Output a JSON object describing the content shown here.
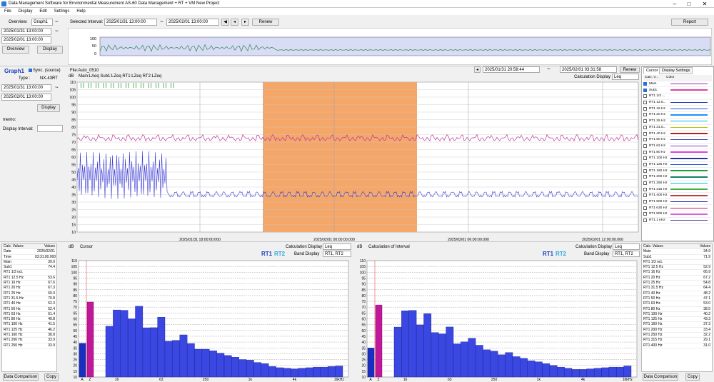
{
  "app": {
    "title": "Data Management Software for Environmental Measurement AS-60 Data Management + RT + VM New Project"
  },
  "menu": [
    "File",
    "Display",
    "Edit",
    "Settings",
    "Help"
  ],
  "overview": {
    "label": "Overview:",
    "graph": "Graph1",
    "start": "2025/01/31 13:00:00",
    "end": "2025/02/01 13:00:00",
    "overview_btn": "Overview",
    "display_btn": "Display",
    "y_ticks": [
      "100",
      "50",
      "0"
    ]
  },
  "interval": {
    "label": "Selected Interval:",
    "start": "2025/01/31 13:00:00",
    "end": "2025/02/01 13:00:00",
    "renew": "Renew",
    "report": "Report"
  },
  "graph": {
    "title": "Graph1",
    "sync_label": "Sync. (source)",
    "type_label": "Type :",
    "type_value": "NX-43RT",
    "start": "2025/01/31 13:00:00",
    "end": "2025/02/01 13:00:00",
    "display_btn": "Display",
    "memo_label": "memo:",
    "display_interval_label": "Display Interval:",
    "file": "File:Auto_0510",
    "unit": "dB",
    "series_label": "Main:LAeq Sub1:LZeq RT1:LZeq RT2:LZeq",
    "nav_start": "2025/01/31 20:58:44",
    "nav_end": "2025/02/01 03:31:58",
    "renew": "Renew",
    "calc_display_label": "Calculation Display",
    "calc_display_value": "Leq",
    "y_ticks": [
      "110",
      "105",
      "100",
      "95",
      "90",
      "85",
      "80",
      "75",
      "70",
      "65",
      "60",
      "55",
      "50",
      "45",
      "40",
      "35",
      "30",
      "25",
      "20",
      "15",
      "10"
    ],
    "x_ticks": [
      "2025/01/31 18:00:00.000",
      "2025/02/01 00:00:00.000",
      "2025/02/01 06:00:00.000",
      "2025/02/01 12:00:00.000"
    ]
  },
  "legend": {
    "tab1": "Cursor",
    "tab2": "Display Settings",
    "col1": "Calc. V...",
    "col2": "Color",
    "items": [
      {
        "name": "Main",
        "on": true,
        "color": "#9b2fae"
      },
      {
        "name": "Sub1",
        "on": true,
        "color": "#e040a0"
      },
      {
        "name": "RT1 1/3 ...",
        "on": false,
        "color": ""
      },
      {
        "name": "RT1 12.5...",
        "on": false,
        "color": "#1a3fbf"
      },
      {
        "name": "RT1 16 Hz",
        "on": false,
        "color": "#2a50d0"
      },
      {
        "name": "RT1 20 Hz",
        "on": false,
        "color": "#1e90ff"
      },
      {
        "name": "RT1 25 Hz",
        "on": false,
        "color": "#00bcd4"
      },
      {
        "name": "RT1 31.5...",
        "on": false,
        "color": "#c0c000"
      },
      {
        "name": "RT1 40 Hz",
        "on": false,
        "color": "#b02020"
      },
      {
        "name": "RT1 50 Hz",
        "on": false,
        "color": "#4040c0"
      },
      {
        "name": "RT1 63 Hz",
        "on": false,
        "color": "#8040c0"
      },
      {
        "name": "RT1 80 Hz",
        "on": false,
        "color": "#e040e0"
      },
      {
        "name": "RT1 100 Hz",
        "on": false,
        "color": "#3030a0"
      },
      {
        "name": "RT1 125 Hz",
        "on": false,
        "color": "#2050d0"
      },
      {
        "name": "RT1 160 Hz",
        "on": false,
        "color": "#20a040"
      },
      {
        "name": "RT1 200 Hz",
        "on": false,
        "color": "#108060"
      },
      {
        "name": "RT1 250 Hz",
        "on": false,
        "color": "#00c0e0"
      },
      {
        "name": "RT1 315 Hz",
        "on": false,
        "color": "#40b040"
      },
      {
        "name": "RT1 400 Hz",
        "on": false,
        "color": "#c04040"
      },
      {
        "name": "RT1 500 Hz",
        "on": false,
        "color": "#2020c0"
      },
      {
        "name": "RT1 630 Hz",
        "on": false,
        "color": "#c02060"
      },
      {
        "name": "RT1 800 Hz",
        "on": false,
        "color": "#e060e0"
      },
      {
        "name": "RT1 1 kHz",
        "on": false,
        "color": "#6040a0"
      }
    ]
  },
  "left_values": {
    "h1": "Calc. Values",
    "h2": "Values",
    "rows": [
      [
        "Date",
        "2025/02/01"
      ],
      [
        "Time",
        "03:31:00.000"
      ],
      [
        "Main",
        "39.0"
      ],
      [
        "Sub1",
        "74.4"
      ],
      [
        "RT1 1/3 oct.",
        ""
      ],
      [
        "RT1 12.5 Hz",
        "53.6"
      ],
      [
        "RT1 16 Hz",
        "67.6"
      ],
      [
        "RT1 20 Hz",
        "67.3"
      ],
      [
        "RT1 25 Hz",
        "60.0"
      ],
      [
        "RT1 31.5 Hz",
        "70.8"
      ],
      [
        "RT1 40 Hz",
        "52.3"
      ],
      [
        "RT1 50 Hz",
        "52.4"
      ],
      [
        "RT1 63 Hz",
        "61.4"
      ],
      [
        "RT1 80 Hz",
        "40.8"
      ],
      [
        "RT1 100 Hz",
        "41.5"
      ],
      [
        "RT1 125 Hz",
        "46.2"
      ],
      [
        "RT1 160 Hz",
        "38.8"
      ],
      [
        "RT1 200 Hz",
        "33.9"
      ],
      [
        "RT1 250 Hz",
        "33.9"
      ]
    ],
    "btn_compare": "Data Comparison",
    "btn_copy": "Copy"
  },
  "right_values": {
    "h1": "Calc. Values",
    "h2": "Values",
    "rows": [
      [
        "Main",
        "34.9"
      ],
      [
        "Sub1",
        "71.9"
      ],
      [
        "RT1 1/3 oct.",
        ""
      ],
      [
        "RT1 12.5 Hz",
        "52.9"
      ],
      [
        "RT1 16 Hz",
        "66.9"
      ],
      [
        "RT1 20 Hz",
        "67.2"
      ],
      [
        "RT1 25 Hz",
        "54.8"
      ],
      [
        "RT1 31.5 Hz",
        "64.4"
      ],
      [
        "RT1 40 Hz",
        "48.2"
      ],
      [
        "RT1 50 Hz",
        "47.1"
      ],
      [
        "RT1 63 Hz",
        "53.0"
      ],
      [
        "RT1 80 Hz",
        "38.5"
      ],
      [
        "RT1 100 Hz",
        "40.2"
      ],
      [
        "RT1 125 Hz",
        "43.3"
      ],
      [
        "RT1 160 Hz",
        "37.3"
      ],
      [
        "RT1 200 Hz",
        "33.4"
      ],
      [
        "RT1 250 Hz",
        "32.2"
      ],
      [
        "RT1 315 Hz",
        "29.1"
      ],
      [
        "RT1 400 Hz",
        "31.0"
      ]
    ],
    "btn_compare": "Data Comparison",
    "btn_copy": "Copy"
  },
  "spec_left": {
    "unit": "dB",
    "title": "Cursor",
    "rt1": "RT1",
    "rt2": "RT2",
    "calc_label": "Calculation Display",
    "calc_value": "Leq",
    "band_label": "Band Display",
    "band_value": "RT1, RT2"
  },
  "spec_right": {
    "unit": "dB",
    "title": "Calculation of Interval",
    "rt1": "RT1",
    "rt2": "RT2",
    "calc_label": "Calculation Display",
    "calc_value": "Leq",
    "band_label": "Band Display",
    "band_value": "RT1, RT2"
  },
  "spec_axis": {
    "y_ticks": [
      "110",
      "105",
      "100",
      "95",
      "90",
      "85",
      "80",
      "75",
      "70",
      "65",
      "60",
      "55",
      "50",
      "45",
      "40",
      "35",
      "30",
      "25",
      "20",
      "15",
      "10"
    ],
    "x_ticks": [
      "A",
      "Z",
      "16",
      "63",
      "250",
      "1k",
      "4k",
      "16kHz"
    ]
  },
  "chart_data": [
    {
      "type": "bar",
      "title": "Cursor",
      "ylabel": "dB",
      "ylim": [
        10,
        110
      ],
      "categories": [
        "A",
        "Z",
        "12.5",
        "16",
        "20",
        "25",
        "31.5",
        "40",
        "50",
        "63",
        "80",
        "100",
        "125",
        "160",
        "200",
        "250",
        "315",
        "400",
        "500",
        "630",
        "800",
        "1k",
        "1.25k",
        "1.6k",
        "2k",
        "2.5k",
        "3.15k",
        "4k",
        "5k",
        "6.3k",
        "8k",
        "10k",
        "12.5k",
        "16kHz"
      ],
      "series": [
        {
          "name": "RT1",
          "values": [
            39.0,
            74.4,
            53.6,
            67.6,
            67.3,
            60.0,
            70.8,
            52.3,
            52.4,
            61.4,
            40.8,
            41.5,
            46.2,
            38.8,
            33.9,
            33.9,
            32.5,
            30.5,
            28.5,
            27.0,
            25.0,
            24.5,
            22.5,
            21.5,
            19.0,
            18.0,
            17.5,
            17.0,
            17.5,
            18.0,
            18.5,
            18.5,
            19.0,
            19.5
          ]
        }
      ]
    },
    {
      "type": "bar",
      "title": "Calculation of Interval",
      "ylabel": "dB",
      "ylim": [
        10,
        110
      ],
      "categories": [
        "A",
        "Z",
        "12.5",
        "16",
        "20",
        "25",
        "31.5",
        "40",
        "50",
        "63",
        "80",
        "100",
        "125",
        "160",
        "200",
        "250",
        "315",
        "400",
        "500",
        "630",
        "800",
        "1k",
        "1.25k",
        "1.6k",
        "2k",
        "2.5k",
        "3.15k",
        "4k",
        "5k",
        "6.3k",
        "8k",
        "10k",
        "12.5k",
        "16kHz"
      ],
      "series": [
        {
          "name": "RT1",
          "values": [
            34.9,
            71.9,
            52.9,
            66.9,
            67.2,
            54.8,
            64.4,
            48.2,
            47.1,
            53.0,
            38.5,
            40.2,
            43.3,
            37.3,
            33.4,
            32.2,
            29.1,
            31.0,
            27.5,
            26.0,
            24.0,
            23.0,
            21.5,
            20.0,
            18.5,
            17.5,
            16.5,
            16.5,
            17.0,
            17.5,
            18.0,
            18.5,
            18.5,
            19.5
          ]
        }
      ]
    }
  ]
}
